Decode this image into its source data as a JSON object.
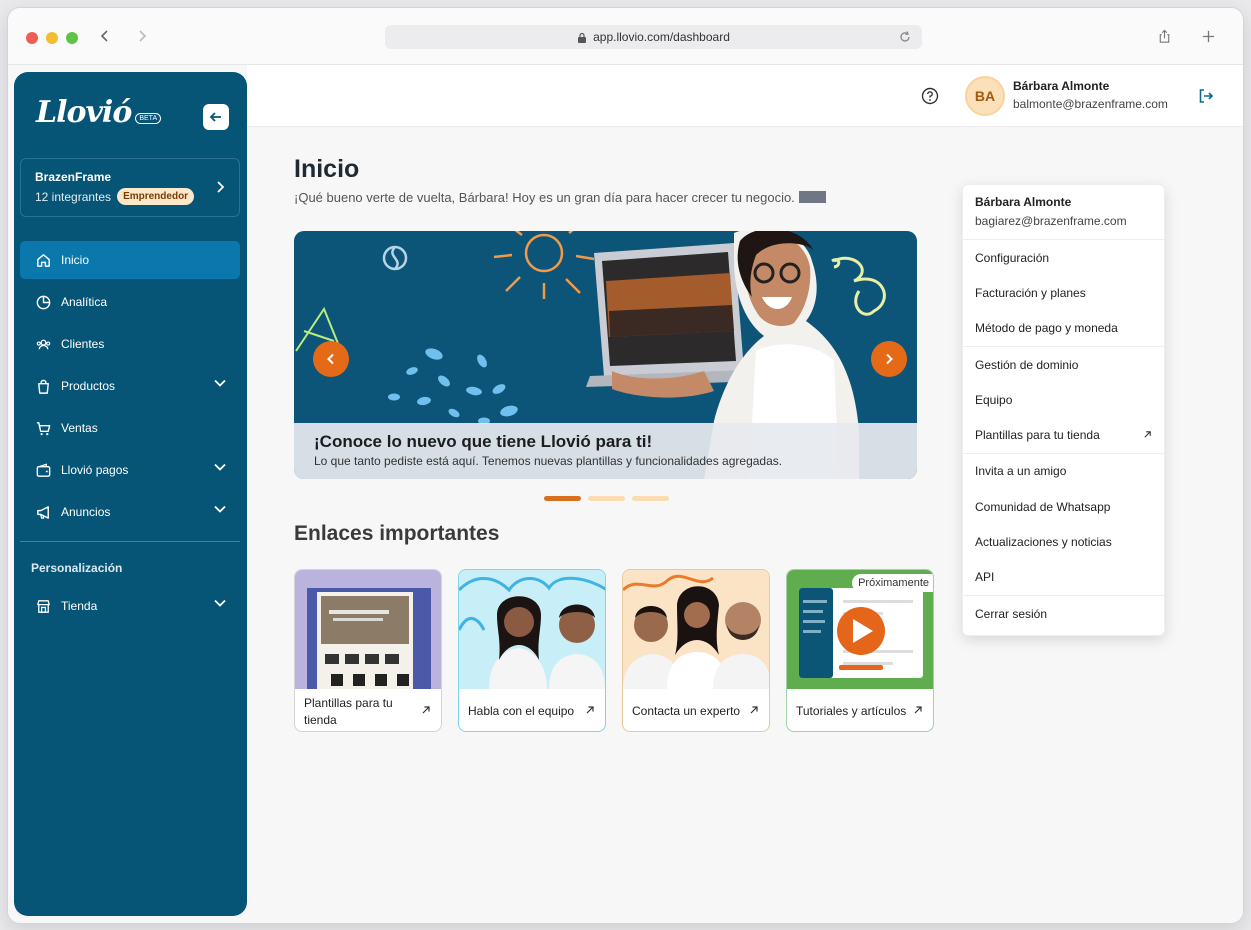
{
  "browser": {
    "url": "app.llovio.com/dashboard"
  },
  "sidebar": {
    "logo": "Llovió",
    "beta": "BETA",
    "org": {
      "name": "BrazenFrame",
      "members": "12 integrantes",
      "plan": "Emprendedor"
    },
    "items": [
      {
        "label": "Inicio",
        "icon": "home-icon",
        "active": true
      },
      {
        "label": "Analítica",
        "icon": "pie-chart-icon"
      },
      {
        "label": "Clientes",
        "icon": "users-icon"
      },
      {
        "label": "Productos",
        "icon": "bag-icon",
        "expandable": true
      },
      {
        "label": "Ventas",
        "icon": "cart-icon"
      },
      {
        "label": "Llovió pagos",
        "icon": "wallet-icon",
        "expandable": true
      },
      {
        "label": "Anuncios",
        "icon": "megaphone-icon",
        "expandable": true
      }
    ],
    "section_title": "Personalización",
    "items2": [
      {
        "label": "Tienda",
        "icon": "store-icon",
        "expandable": true
      }
    ]
  },
  "header": {
    "avatar_initials": "BA",
    "user_name": "Bárbara Almonte",
    "user_email": "balmonte@brazenframe.com"
  },
  "main": {
    "title": "Inicio",
    "welcome": "¡Qué bueno verte de vuelta, Bárbara! Hoy es un gran día para hacer crecer tu negocio.",
    "banner": {
      "title": "¡Conoce lo nuevo que tiene Llovió para ti!",
      "subtitle": "Lo que tanto pediste está aquí. Tenemos nuevas plantillas y funcionalidades agregadas."
    },
    "carousel_dots": 3,
    "links_title": "Enlaces importantes",
    "cards": [
      {
        "label": "Plantillas para tu tienda"
      },
      {
        "label": "Habla con el equipo"
      },
      {
        "label": "Contacta un experto"
      },
      {
        "label": "Tutoriales y artículos",
        "badge": "Próximamente"
      }
    ]
  },
  "dropdown": {
    "name": "Bárbara Almonte",
    "email": "bagiarez@brazenframe.com",
    "groups": [
      [
        "Configuración",
        "Facturación y planes",
        "Método de pago y moneda"
      ],
      [
        "Gestión de dominio",
        "Equipo",
        "Plantillas para tu tienda"
      ],
      [
        "Invita a un amigo",
        "Comunidad de Whatsapp",
        "Actualizaciones y noticias",
        "API"
      ],
      [
        "Cerrar sesión"
      ]
    ]
  },
  "colors": {
    "sidebar": "#065476",
    "active_item": "#0a78ad",
    "accent_orange": "#e56a17",
    "badge_bg": "#fbe7c9"
  }
}
